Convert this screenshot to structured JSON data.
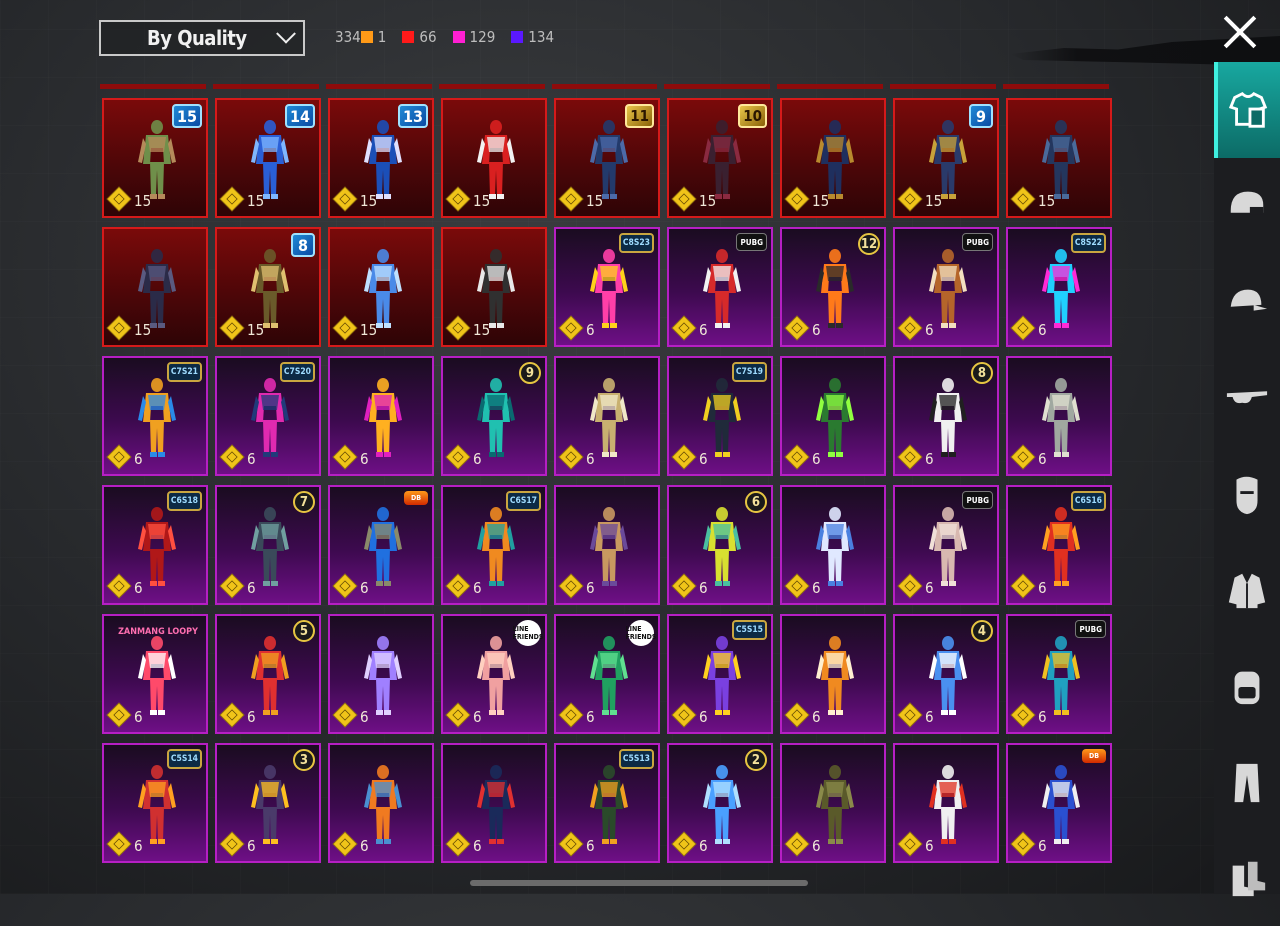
{
  "header": {
    "sort_label": "By Quality",
    "total": "334",
    "counts": [
      {
        "value": "1",
        "color": "#ff9a17"
      },
      {
        "value": "66",
        "color": "#ff1a1a"
      },
      {
        "value": "129",
        "color": "#ff1fd2"
      },
      {
        "value": "134",
        "color": "#5a18ff"
      }
    ]
  },
  "items": [
    {
      "quality": "legendary",
      "price": "15",
      "badge": "15",
      "badge_type": "num",
      "icon": "outfit-camo"
    },
    {
      "quality": "legendary",
      "price": "15",
      "badge": "14",
      "badge_type": "num",
      "icon": "outfit-blue-wings"
    },
    {
      "quality": "legendary",
      "price": "15",
      "badge": "13",
      "badge_type": "num",
      "icon": "outfit-blue-armor"
    },
    {
      "quality": "legendary",
      "price": "15",
      "badge": "",
      "badge_type": "",
      "icon": "outfit-jester"
    },
    {
      "quality": "legendary",
      "price": "15",
      "badge": "11",
      "badge_type": "num-gold",
      "icon": "outfit-dark-hood"
    },
    {
      "quality": "legendary",
      "price": "15",
      "badge": "10",
      "badge_type": "num-gold",
      "icon": "outfit-shadow"
    },
    {
      "quality": "legendary",
      "price": "15",
      "badge": "",
      "badge_type": "",
      "icon": "outfit-robe"
    },
    {
      "quality": "legendary",
      "price": "15",
      "badge": "9",
      "badge_type": "num",
      "icon": "outfit-gold-trim"
    },
    {
      "quality": "legendary",
      "price": "15",
      "badge": "",
      "badge_type": "",
      "icon": "outfit-navy"
    },
    {
      "quality": "legendary",
      "price": "15",
      "badge": "",
      "badge_type": "",
      "icon": "outfit-night"
    },
    {
      "quality": "legendary",
      "price": "15",
      "badge": "8",
      "badge_type": "num",
      "icon": "outfit-gold-robe"
    },
    {
      "quality": "legendary",
      "price": "15",
      "badge": "",
      "badge_type": "",
      "icon": "outfit-ice"
    },
    {
      "quality": "legendary",
      "price": "15",
      "badge": "",
      "badge_type": "",
      "icon": "outfit-stripes"
    },
    {
      "quality": "epic",
      "price": "6",
      "badge": "C8S23",
      "badge_type": "season",
      "icon": "outfit-neon-skirt"
    },
    {
      "quality": "epic",
      "price": "6",
      "badge": "PUBG",
      "badge_type": "collab",
      "icon": "outfit-red-jacket"
    },
    {
      "quality": "epic",
      "price": "6",
      "badge": "12",
      "badge_type": "hex",
      "icon": "outfit-halloween"
    },
    {
      "quality": "epic",
      "price": "6",
      "badge": "PUBG",
      "badge_type": "collab",
      "icon": "outfit-tan-suit"
    },
    {
      "quality": "epic",
      "price": "6",
      "badge": "C8S22",
      "badge_type": "season",
      "icon": "outfit-neon"
    },
    {
      "quality": "epic",
      "price": "6",
      "badge": "C7S21",
      "badge_type": "season",
      "icon": "outfit-racer"
    },
    {
      "quality": "epic",
      "price": "6",
      "badge": "C7S20",
      "badge_type": "season",
      "icon": "outfit-pink-puffer"
    },
    {
      "quality": "epic",
      "price": "6",
      "badge": "",
      "badge_type": "",
      "icon": "outfit-pink-orange"
    },
    {
      "quality": "epic",
      "price": "6",
      "badge": "9",
      "badge_type": "hex",
      "icon": "outfit-teal-dress"
    },
    {
      "quality": "epic",
      "price": "6",
      "badge": "",
      "badge_type": "",
      "icon": "outfit-khaki"
    },
    {
      "quality": "epic",
      "price": "6",
      "badge": "C7S19",
      "badge_type": "season",
      "icon": "outfit-tech"
    },
    {
      "quality": "epic",
      "price": "6",
      "badge": "",
      "badge_type": "",
      "icon": "outfit-graffiti"
    },
    {
      "quality": "epic",
      "price": "6",
      "badge": "8",
      "badge_type": "hex",
      "icon": "outfit-white-hood"
    },
    {
      "quality": "epic",
      "price": "6",
      "badge": "",
      "badge_type": "",
      "icon": "outfit-silver"
    },
    {
      "quality": "epic",
      "price": "6",
      "badge": "C6S18",
      "badge_type": "season",
      "icon": "outfit-red-robot"
    },
    {
      "quality": "epic",
      "price": "6",
      "badge": "7",
      "badge_type": "hex",
      "icon": "outfit-grey-hood"
    },
    {
      "quality": "epic",
      "price": "6",
      "badge": "DB",
      "badge_type": "dragon",
      "icon": "outfit-blue-shirt"
    },
    {
      "quality": "epic",
      "price": "6",
      "badge": "C6S17",
      "badge_type": "season",
      "icon": "outfit-colorblock"
    },
    {
      "quality": "epic",
      "price": "6",
      "badge": "",
      "badge_type": "",
      "icon": "outfit-patchwork"
    },
    {
      "quality": "epic",
      "price": "6",
      "badge": "6",
      "badge_type": "hex",
      "icon": "outfit-yellow-green"
    },
    {
      "quality": "epic",
      "price": "6",
      "badge": "",
      "badge_type": "",
      "icon": "outfit-frills"
    },
    {
      "quality": "epic",
      "price": "6",
      "badge": "PUBG",
      "badge_type": "collab",
      "icon": "outfit-bodysuit"
    },
    {
      "quality": "epic",
      "price": "6",
      "badge": "C6S16",
      "badge_type": "season",
      "icon": "outfit-flame"
    },
    {
      "quality": "epic",
      "price": "6",
      "badge": "ZANMANG LOOPY",
      "badge_type": "loopy",
      "icon": "outfit-pink-onesie"
    },
    {
      "quality": "epic",
      "price": "6",
      "badge": "5",
      "badge_type": "hex",
      "icon": "outfit-harlequin"
    },
    {
      "quality": "epic",
      "price": "6",
      "badge": "",
      "badge_type": "",
      "icon": "outfit-lavender-dress"
    },
    {
      "quality": "epic",
      "price": "6",
      "badge": "LINE FRIENDS",
      "badge_type": "line",
      "icon": "outfit-peach-onesie"
    },
    {
      "quality": "epic",
      "price": "6",
      "badge": "LINE FRIENDS",
      "badge_type": "line",
      "icon": "outfit-green-onesie"
    },
    {
      "quality": "epic",
      "price": "6",
      "badge": "C5S15",
      "badge_type": "season",
      "icon": "outfit-rainbow"
    },
    {
      "quality": "epic",
      "price": "6",
      "badge": "",
      "badge_type": "",
      "icon": "outfit-leopard"
    },
    {
      "quality": "epic",
      "price": "6",
      "badge": "4",
      "badge_type": "hex",
      "icon": "outfit-bunny-hoodie"
    },
    {
      "quality": "epic",
      "price": "6",
      "badge": "PUBG",
      "badge_type": "collab",
      "icon": "outfit-festival"
    },
    {
      "quality": "epic",
      "price": "6",
      "badge": "C5S14",
      "badge_type": "season",
      "icon": "outfit-carnival"
    },
    {
      "quality": "epic",
      "price": "6",
      "badge": "3",
      "badge_type": "hex",
      "icon": "outfit-purple-armor"
    },
    {
      "quality": "epic",
      "price": "6",
      "badge": "",
      "badge_type": "",
      "icon": "outfit-orange-vest"
    },
    {
      "quality": "epic",
      "price": "6",
      "badge": "",
      "badge_type": "",
      "icon": "outfit-sailor"
    },
    {
      "quality": "epic",
      "price": "6",
      "badge": "C5S13",
      "badge_type": "season",
      "icon": "outfit-green-camo"
    },
    {
      "quality": "epic",
      "price": "6",
      "badge": "2",
      "badge_type": "hex",
      "icon": "outfit-blue-crystal"
    },
    {
      "quality": "epic",
      "price": "6",
      "badge": "",
      "badge_type": "",
      "icon": "outfit-olive"
    },
    {
      "quality": "epic",
      "price": "6",
      "badge": "",
      "badge_type": "",
      "icon": "outfit-mascot"
    },
    {
      "quality": "epic",
      "price": "6",
      "badge": "DB",
      "badge_type": "dragon",
      "icon": "outfit-blue-hair"
    }
  ],
  "sidebar": [
    {
      "name": "outfit-tab-icon",
      "active": true
    },
    {
      "name": "headwear-tab-icon",
      "active": false
    },
    {
      "name": "cap-tab-icon",
      "active": false
    },
    {
      "name": "eyewear-tab-icon",
      "active": false
    },
    {
      "name": "mask-tab-icon",
      "active": false
    },
    {
      "name": "jacket-tab-icon",
      "active": false
    },
    {
      "name": "backpack-tab-icon",
      "active": false
    },
    {
      "name": "pants-tab-icon",
      "active": false
    },
    {
      "name": "shoes-tab-icon",
      "active": false
    }
  ]
}
